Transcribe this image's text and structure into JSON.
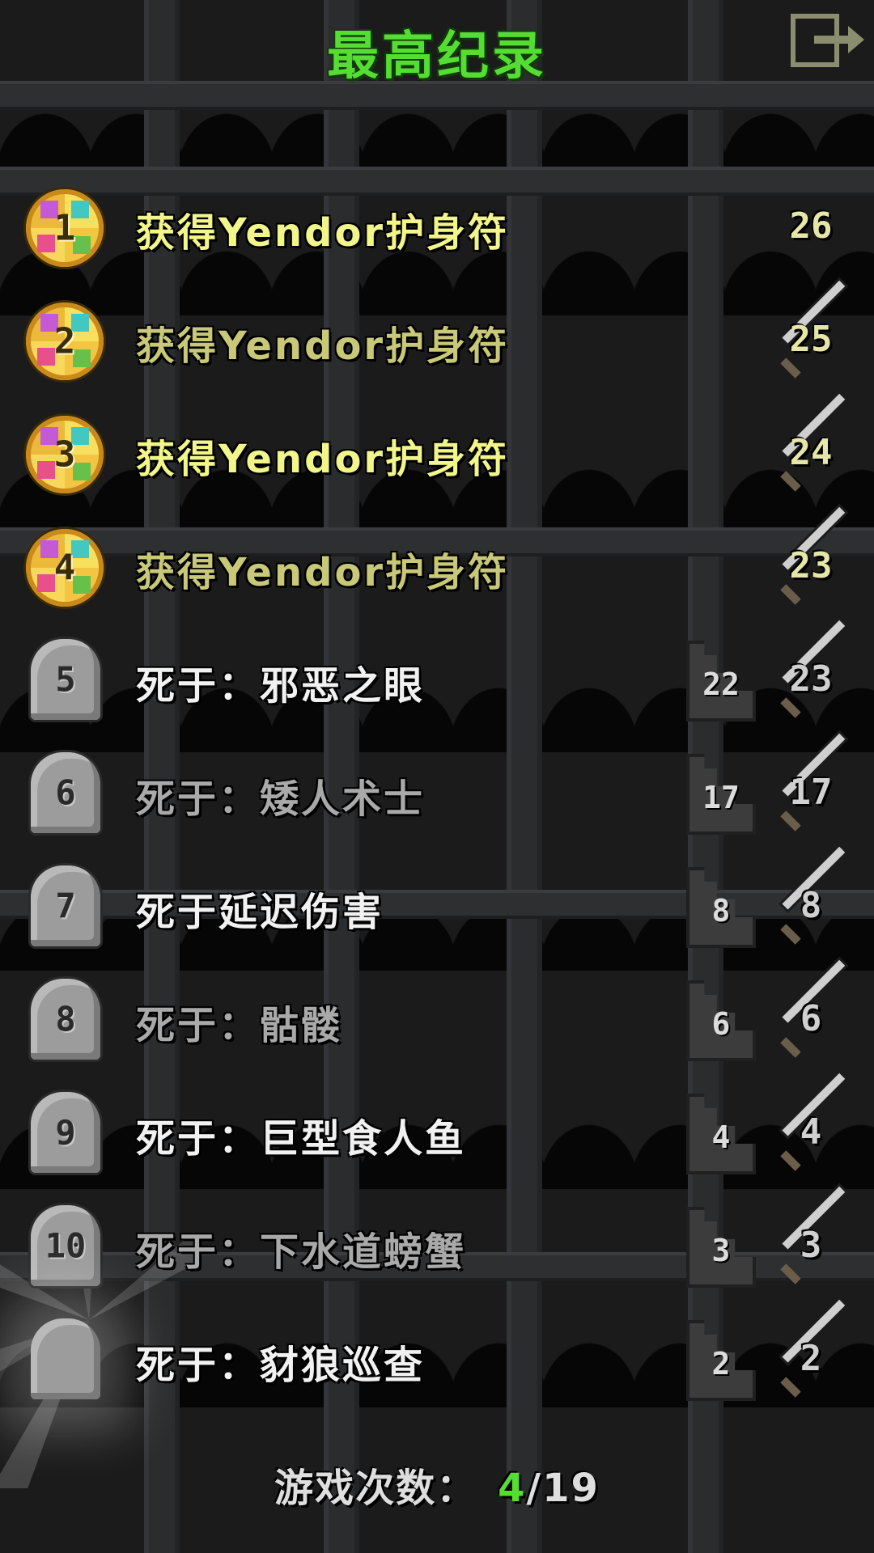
{
  "title": "最高纪录",
  "exit_icon": "exit-door-icon",
  "colors": {
    "title": "#55dd33",
    "win_text": "#f2f58a",
    "lose_text": "#f1f1f1",
    "background": "#1b1b1c"
  },
  "records": [
    {
      "rank": "1",
      "type": "win",
      "description": "获得Yendor护身符",
      "depth": "",
      "level": "26",
      "highlight": true
    },
    {
      "rank": "2",
      "type": "win",
      "description": "获得Yendor护身符",
      "depth": "",
      "level": "25",
      "highlight": false
    },
    {
      "rank": "3",
      "type": "win",
      "description": "获得Yendor护身符",
      "depth": "",
      "level": "24",
      "highlight": true
    },
    {
      "rank": "4",
      "type": "win",
      "description": "获得Yendor护身符",
      "depth": "",
      "level": "23",
      "highlight": false
    },
    {
      "rank": "5",
      "type": "death",
      "description": "死于：邪恶之眼",
      "depth": "22",
      "level": "23",
      "highlight": true
    },
    {
      "rank": "6",
      "type": "death",
      "description": "死于：矮人术士",
      "depth": "17",
      "level": "17",
      "highlight": false
    },
    {
      "rank": "7",
      "type": "death",
      "description": "死于延迟伤害",
      "depth": "8",
      "level": "8",
      "highlight": true
    },
    {
      "rank": "8",
      "type": "death",
      "description": "死于：骷髅",
      "depth": "6",
      "level": "6",
      "highlight": false
    },
    {
      "rank": "9",
      "type": "death",
      "description": "死于：巨型食人鱼",
      "depth": "4",
      "level": "4",
      "highlight": true
    },
    {
      "rank": "10",
      "type": "death",
      "description": "死于：下水道螃蟹",
      "depth": "3",
      "level": "3",
      "highlight": false
    },
    {
      "rank": "",
      "type": "death-latest",
      "description": "死于：豺狼巡查",
      "depth": "2",
      "level": "2",
      "highlight": true
    }
  ],
  "footer": {
    "label": "游戏次数：",
    "wins": "4",
    "slash": "/",
    "total": "19"
  }
}
